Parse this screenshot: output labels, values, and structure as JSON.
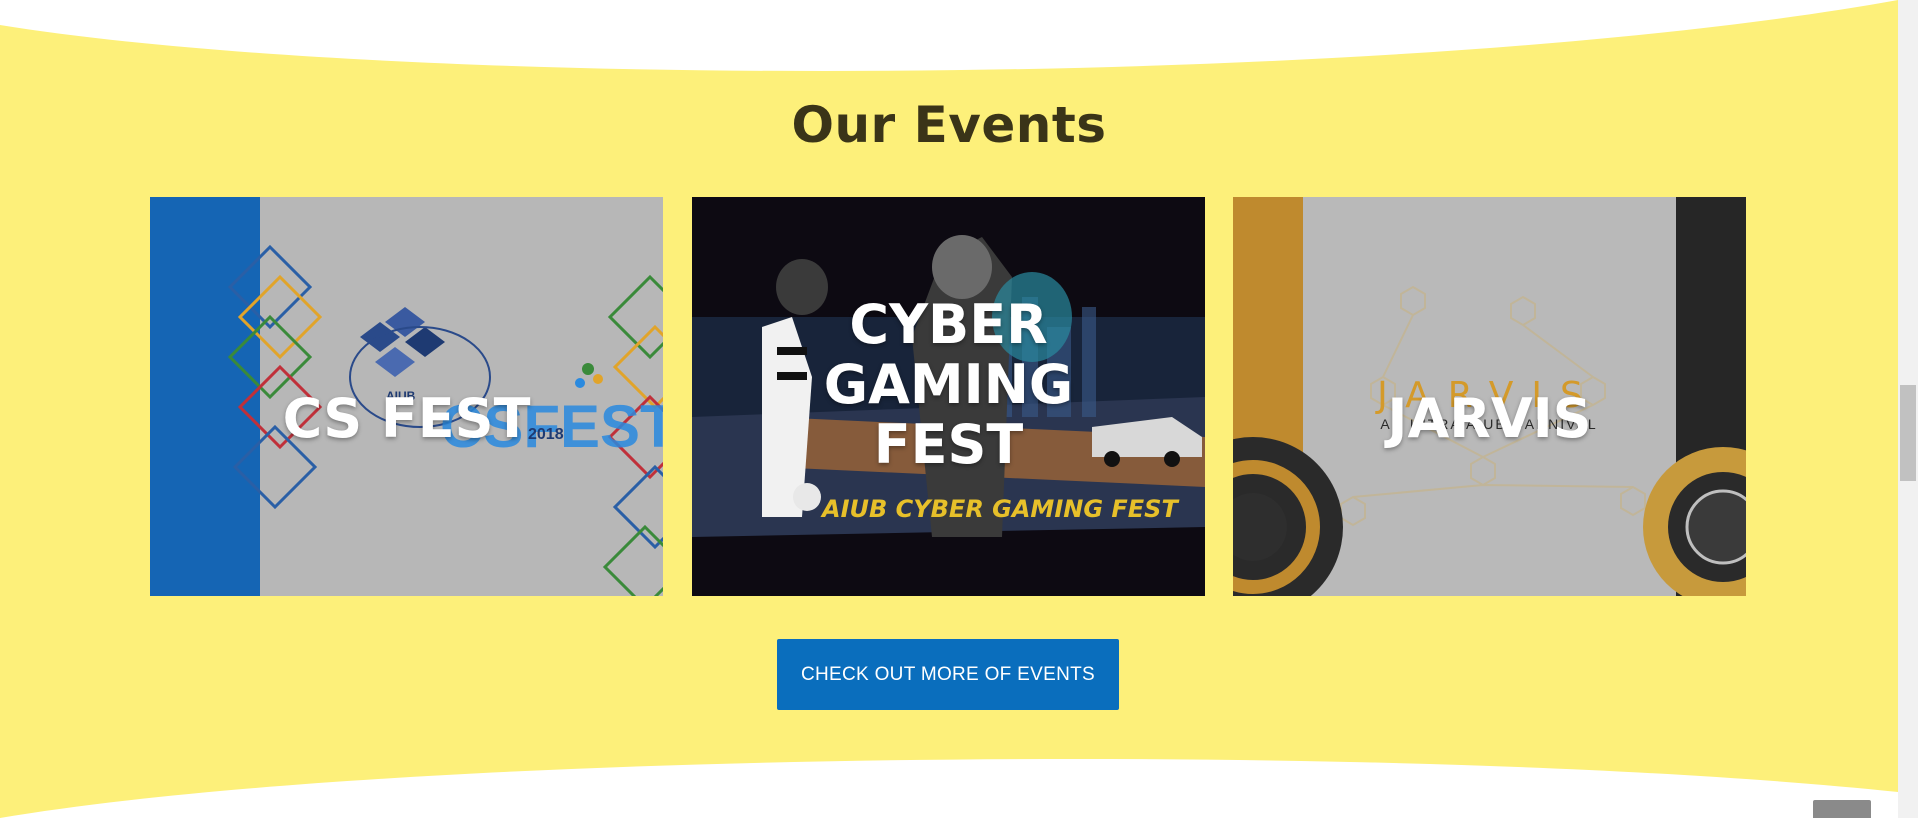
{
  "section": {
    "heading": "Our Events"
  },
  "events": [
    {
      "title": "CS FEST",
      "art_text": {
        "brand": "AIUB",
        "name": "CSFEST",
        "year": "2018"
      }
    },
    {
      "title": "CYBER GAMING FEST",
      "art_text": {
        "caption": "AIUB CYBER GAMING FEST"
      }
    },
    {
      "title": "JARVIS",
      "art_text": {
        "name": "JARVIS",
        "tagline": "AN INTRA AIUB CARNIVAL"
      }
    }
  ],
  "cta": {
    "label": "CHECK OUT MORE OF EVENTS"
  },
  "colors": {
    "section_bg": "#fdf07a",
    "heading": "#3a3418",
    "button": "#0a6ebd",
    "label": "#ffffff"
  },
  "icons": {
    "scroll_top": "chevron-up-icon"
  }
}
